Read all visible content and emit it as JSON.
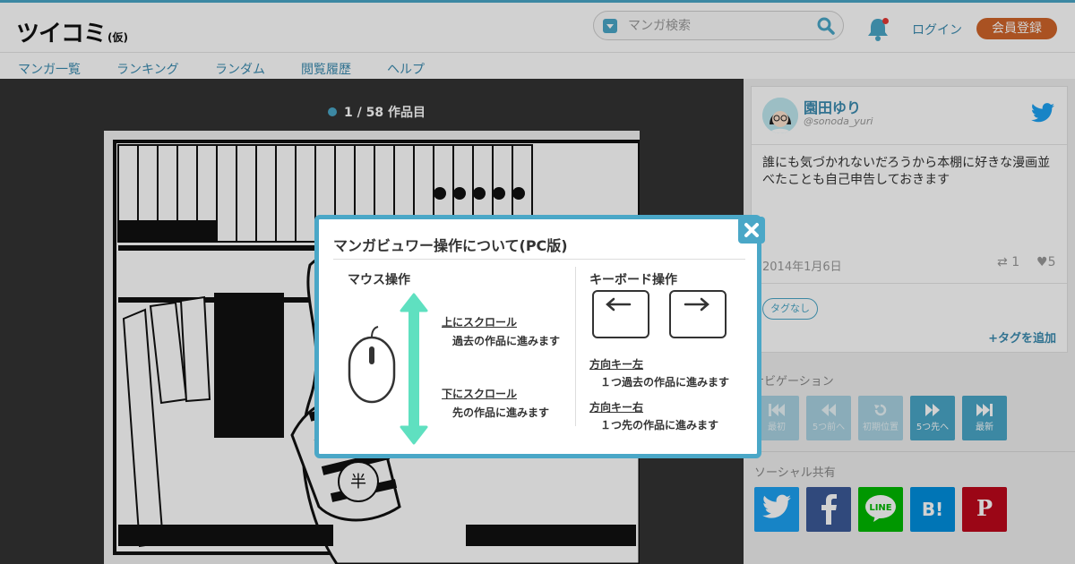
{
  "header": {
    "logo": "ツイコミ",
    "logo_sub": "(仮)",
    "search_placeholder": "マンガ検索",
    "login": "ログイン",
    "register": "会員登録",
    "nav": [
      "マンガ一覧",
      "ランキング",
      "ランダム",
      "閲覧履歴",
      "ヘルプ"
    ]
  },
  "viewer": {
    "counter": "1 / 58 作品目"
  },
  "tweet": {
    "name": "園田ゆり",
    "handle": "@sonoda_yuri",
    "text": "誰にも気づかれないだろうから本棚に好きな漫画並べたことも自己申告しておきます",
    "date": "2014年1月6日",
    "retweets": "1",
    "favorites": "5",
    "tag": "タグなし",
    "add_tag": "タグを追加"
  },
  "navigation": {
    "title": "ナビゲーション",
    "buttons": [
      "最初",
      "5つ前へ",
      "初期位置",
      "5つ先へ",
      "最新"
    ]
  },
  "social": {
    "title": "ソーシャル共有",
    "colors": {
      "twitter": "#1da1f2",
      "facebook": "#3b5998",
      "line": "#00b900",
      "hatena": "#008fde",
      "pinterest": "#bd081c"
    }
  },
  "modal": {
    "title": "マンガビュワー操作について(PC版)",
    "mouse_heading": "マウス操作",
    "scroll_up": "上にスクロール",
    "scroll_up_desc": "過去の作品に進みます",
    "scroll_down": "下にスクロール",
    "scroll_down_desc": "先の作品に進みます",
    "keyboard_heading": "キーボード操作",
    "key_left": "方向キー左",
    "key_left_desc": "１つ過去の作品に進みます",
    "key_right": "方向キー右",
    "key_right_desc": "１つ先の作品に進みます"
  },
  "colors": {
    "accent": "#4aa7c7",
    "register": "#d0642a",
    "scroll_arrow": "#5fe0c0"
  }
}
